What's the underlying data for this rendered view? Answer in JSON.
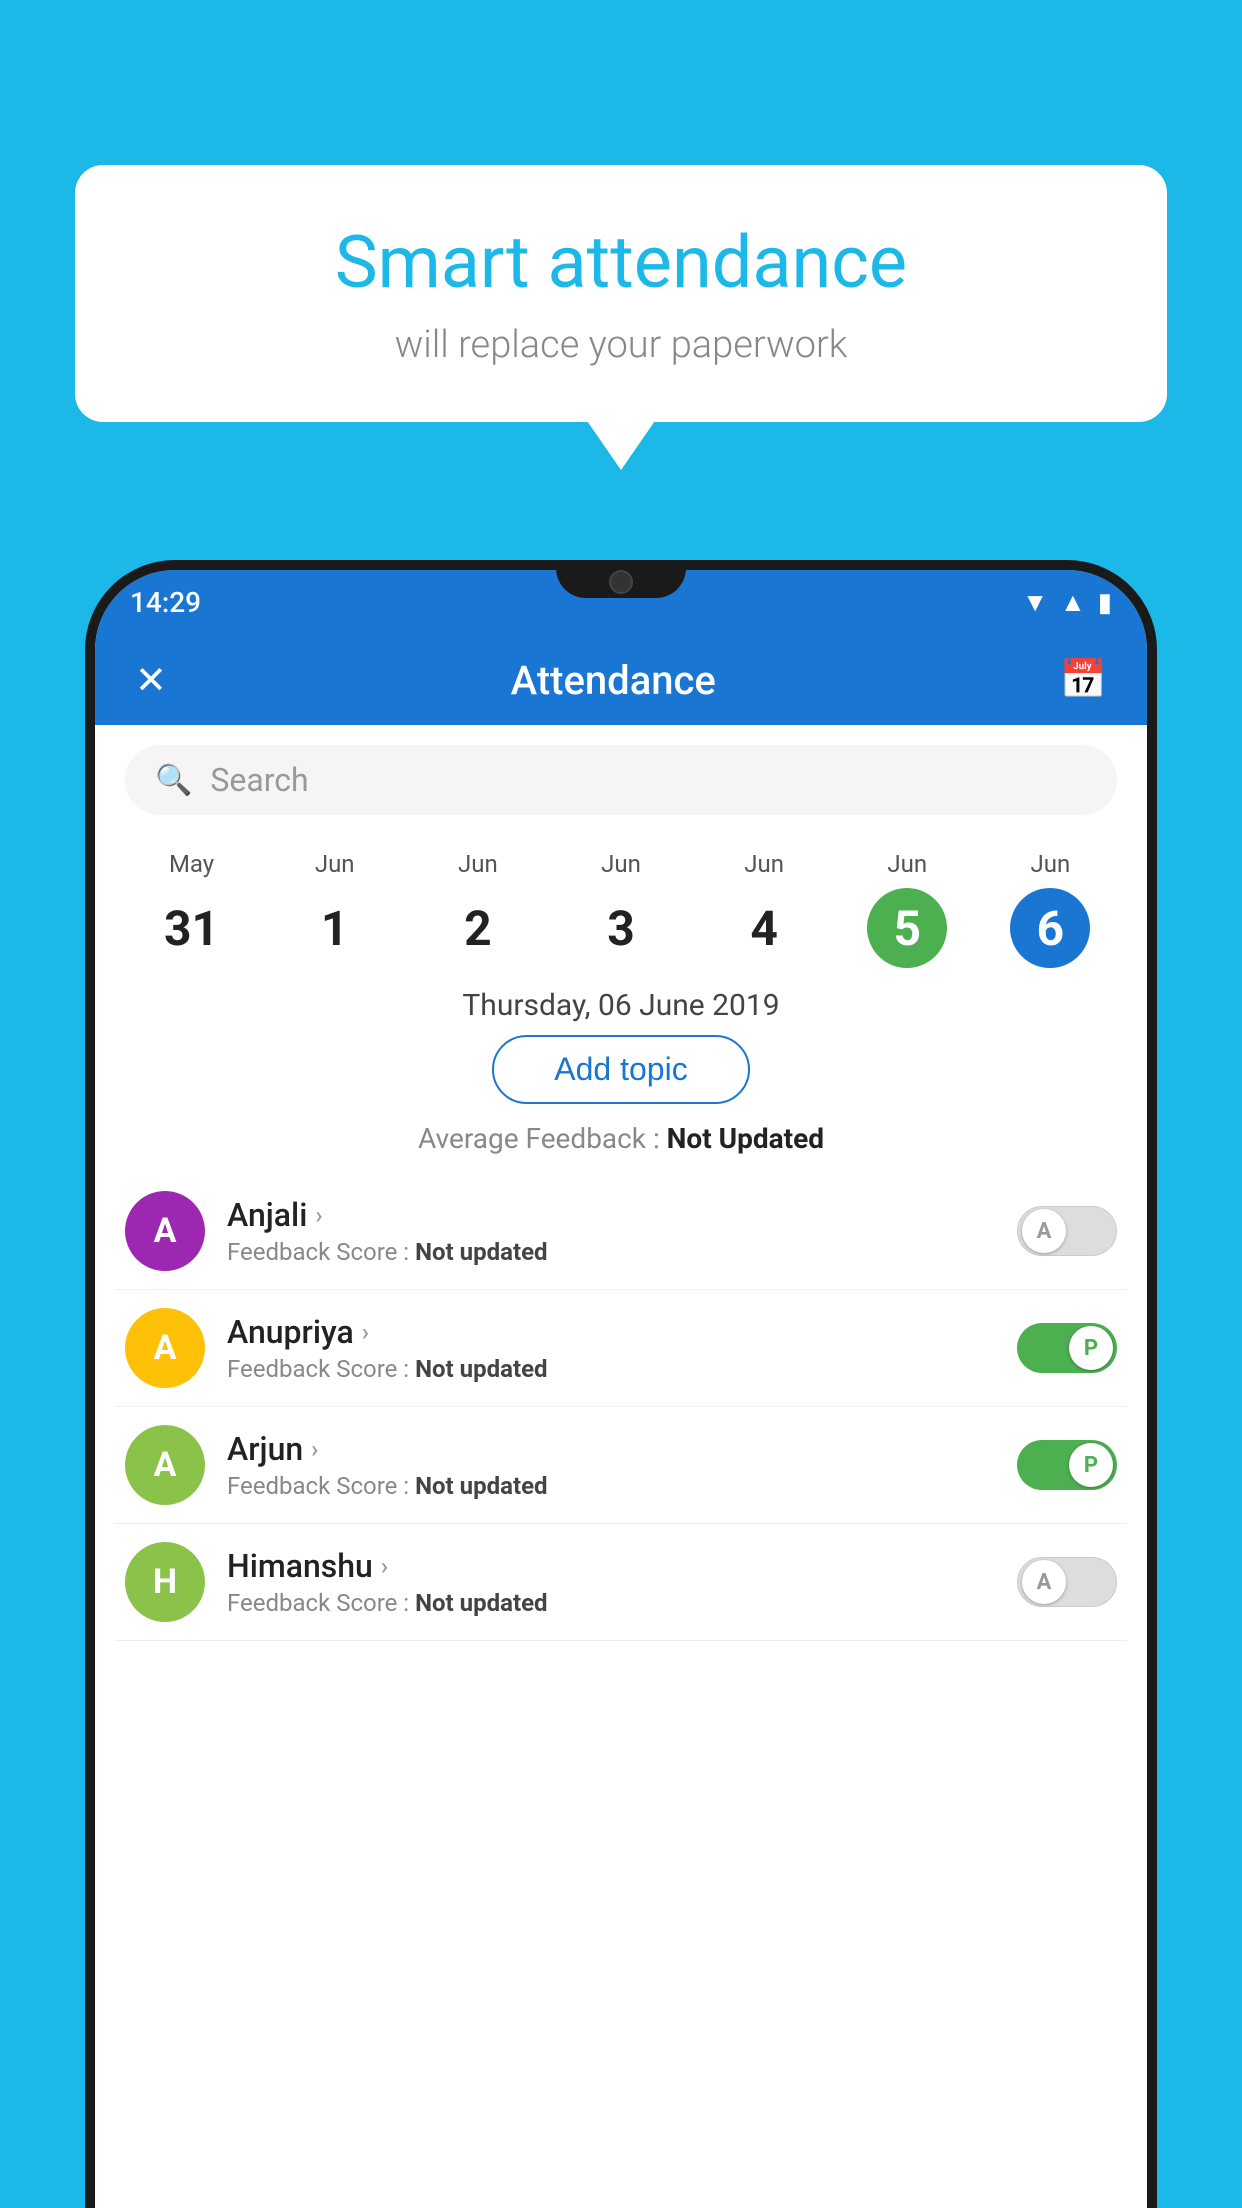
{
  "background_color": "#1BB8E8",
  "bubble": {
    "title": "Smart attendance",
    "subtitle": "will replace your paperwork"
  },
  "status_bar": {
    "time": "14:29",
    "wifi_icon": "▼",
    "signal_icon": "▲",
    "battery_icon": "▮"
  },
  "app_bar": {
    "title": "Attendance",
    "close_icon": "✕",
    "calendar_icon": "📅"
  },
  "search": {
    "placeholder": "Search"
  },
  "calendar": {
    "days": [
      {
        "month": "May",
        "num": "31",
        "state": "normal"
      },
      {
        "month": "Jun",
        "num": "1",
        "state": "normal"
      },
      {
        "month": "Jun",
        "num": "2",
        "state": "normal"
      },
      {
        "month": "Jun",
        "num": "3",
        "state": "normal"
      },
      {
        "month": "Jun",
        "num": "4",
        "state": "normal"
      },
      {
        "month": "Jun",
        "num": "5",
        "state": "today"
      },
      {
        "month": "Jun",
        "num": "6",
        "state": "selected"
      }
    ]
  },
  "selected_date": "Thursday, 06 June 2019",
  "add_topic_label": "Add topic",
  "avg_feedback_label": "Average Feedback : ",
  "avg_feedback_value": "Not Updated",
  "students": [
    {
      "name": "Anjali",
      "avatar_letter": "A",
      "avatar_color": "#9C27B0",
      "feedback_label": "Feedback Score : ",
      "feedback_value": "Not updated",
      "toggle_state": "off",
      "toggle_letter": "A"
    },
    {
      "name": "Anupriya",
      "avatar_letter": "A",
      "avatar_color": "#FFC107",
      "feedback_label": "Feedback Score : ",
      "feedback_value": "Not updated",
      "toggle_state": "on",
      "toggle_letter": "P"
    },
    {
      "name": "Arjun",
      "avatar_letter": "A",
      "avatar_color": "#8BC34A",
      "feedback_label": "Feedback Score : ",
      "feedback_value": "Not updated",
      "toggle_state": "on",
      "toggle_letter": "P"
    },
    {
      "name": "Himanshu",
      "avatar_letter": "H",
      "avatar_color": "#8BC34A",
      "feedback_label": "Feedback Score : ",
      "feedback_value": "Not updated",
      "toggle_state": "off",
      "toggle_letter": "A"
    }
  ]
}
